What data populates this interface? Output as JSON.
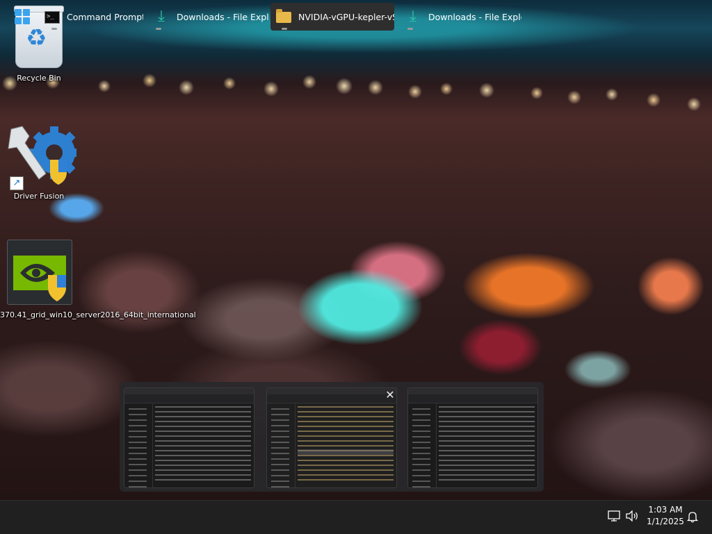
{
  "desktop": {
    "icons": [
      {
        "label": "Recycle Bin",
        "icon": "recycle-bin-icon"
      },
      {
        "label": "Driver Fusion",
        "icon": "driver-fusion-icon"
      },
      {
        "label": "370.41_grid_win10_server2016_64bit_international",
        "icon": "nvidia-installer-icon"
      }
    ]
  },
  "previews": {
    "count": 3,
    "close_glyph": "✕"
  },
  "taskbar": {
    "items": [
      {
        "label": "Command Prompt",
        "icon": "command-prompt-icon"
      },
      {
        "label": "Downloads - File Explor",
        "icon": "download-arrow-icon"
      },
      {
        "label": "NVIDIA-vGPU-kepler-vS",
        "icon": "folder-icon",
        "active": true
      },
      {
        "label": "Downloads - File Explor",
        "icon": "download-arrow-icon"
      }
    ],
    "tray": {
      "time": "1:03 AM",
      "date": "1/1/2025"
    }
  },
  "colors": {
    "taskbar": "#202020",
    "start_accent": "#3ba4ee",
    "download_accent": "#2fc4a4",
    "folder": "#e8b94a"
  }
}
